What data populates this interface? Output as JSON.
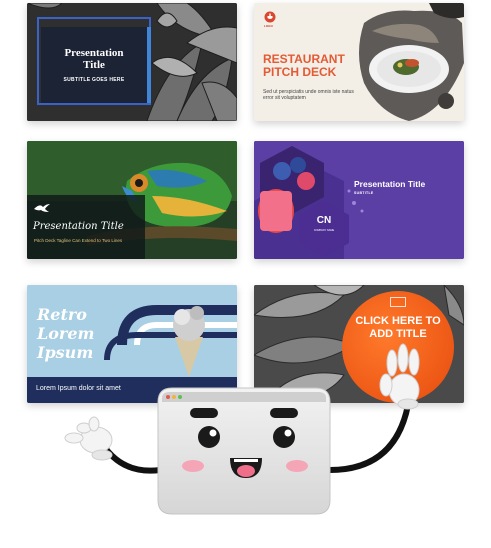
{
  "templates": [
    {
      "title": "Presentation Title",
      "subtitle": "SUBTITLE GOES HERE"
    },
    {
      "logo_label": "LOGO",
      "title": "RESTAURANT PITCH DECK",
      "description": "Sed ut perspiciatis unde omnis iste natus error sit voluptatem"
    },
    {
      "title": "Presentation Title",
      "subtitle": "Pitch Deck Tagline Can Extend to Two Lines"
    },
    {
      "title": "Presentation Title",
      "subtitle": "SUBTITLE",
      "badge": "CN",
      "badge_sub": "COMPANY NAME"
    },
    {
      "title": "Retro Lorem Ipsum",
      "description": "Lorem Ipsum dolor sit amet"
    },
    {
      "title": "CLICK HERE TO ADD TITLE"
    }
  ],
  "colors": {
    "navy": "#1b2335",
    "coral": "#e35a35",
    "purple": "#5b3fa5",
    "retro_blue": "#a8cfe4",
    "retro_navy": "#1f2e5c",
    "orange": "#e64a0d"
  },
  "mascot": {
    "name": "browser-window-mascot",
    "dots": [
      "#e15a4e",
      "#f2b33d",
      "#5fbf55"
    ]
  }
}
